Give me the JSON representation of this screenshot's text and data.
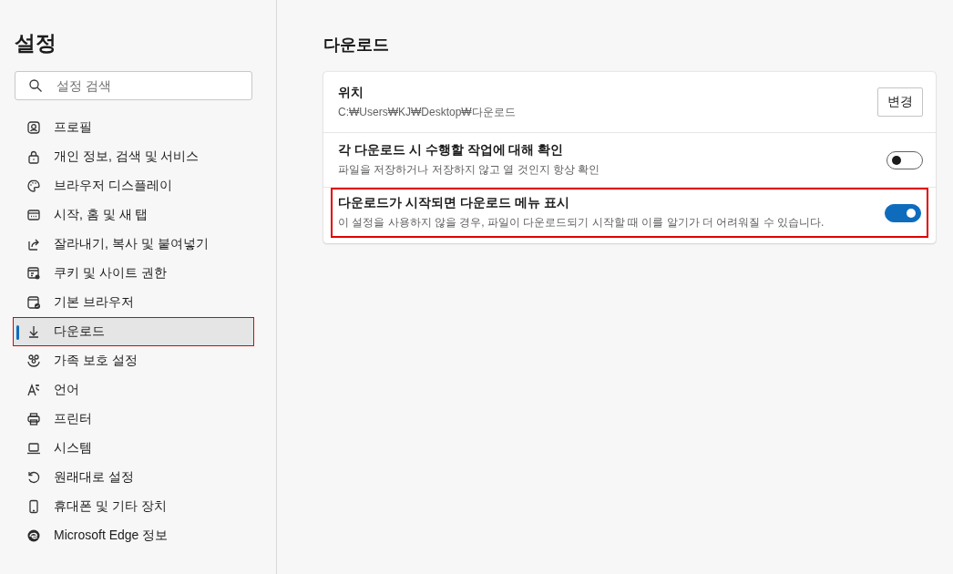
{
  "sidebar": {
    "title": "설정",
    "search": {
      "placeholder": "설정 검색"
    },
    "items": [
      {
        "label": "프로필",
        "selected": false,
        "highlighted": false
      },
      {
        "label": "개인 정보, 검색 및 서비스",
        "selected": false,
        "highlighted": false
      },
      {
        "label": "브라우저 디스플레이",
        "selected": false,
        "highlighted": false
      },
      {
        "label": "시작, 홈 및 새 탭",
        "selected": false,
        "highlighted": false
      },
      {
        "label": "잘라내기, 복사 및 붙여넣기",
        "selected": false,
        "highlighted": false
      },
      {
        "label": "쿠키 및 사이트 권한",
        "selected": false,
        "highlighted": false
      },
      {
        "label": "기본 브라우저",
        "selected": false,
        "highlighted": false
      },
      {
        "label": "다운로드",
        "selected": true,
        "highlighted": true
      },
      {
        "label": "가족 보호 설정",
        "selected": false,
        "highlighted": false
      },
      {
        "label": "언어",
        "selected": false,
        "highlighted": false
      },
      {
        "label": "프린터",
        "selected": false,
        "highlighted": false
      },
      {
        "label": "시스템",
        "selected": false,
        "highlighted": false
      },
      {
        "label": "원래대로 설정",
        "selected": false,
        "highlighted": false
      },
      {
        "label": "휴대폰 및 기타 장치",
        "selected": false,
        "highlighted": false
      },
      {
        "label": "Microsoft Edge 정보",
        "selected": false,
        "highlighted": false
      }
    ]
  },
  "main": {
    "title": "다운로드",
    "settings": [
      {
        "kind": "button",
        "title": "위치",
        "description": "C:₩Users₩KJ₩Desktop₩다운로드",
        "button": "변경",
        "highlighted": false
      },
      {
        "kind": "toggle",
        "title": "각 다운로드 시 수행할 작업에 대해 확인",
        "description": "파일을 저장하거나 저장하지 않고 열 것인지 항상 확인",
        "on": false,
        "highlighted": false
      },
      {
        "kind": "toggle",
        "title": "다운로드가 시작되면 다운로드 메뉴 표시",
        "description": "이 설정을 사용하지 않을 경우, 파일이 다운로드되기 시작할 때 이를 알기가 더 어려워질 수 있습니다.",
        "on": true,
        "highlighted": true
      }
    ]
  }
}
